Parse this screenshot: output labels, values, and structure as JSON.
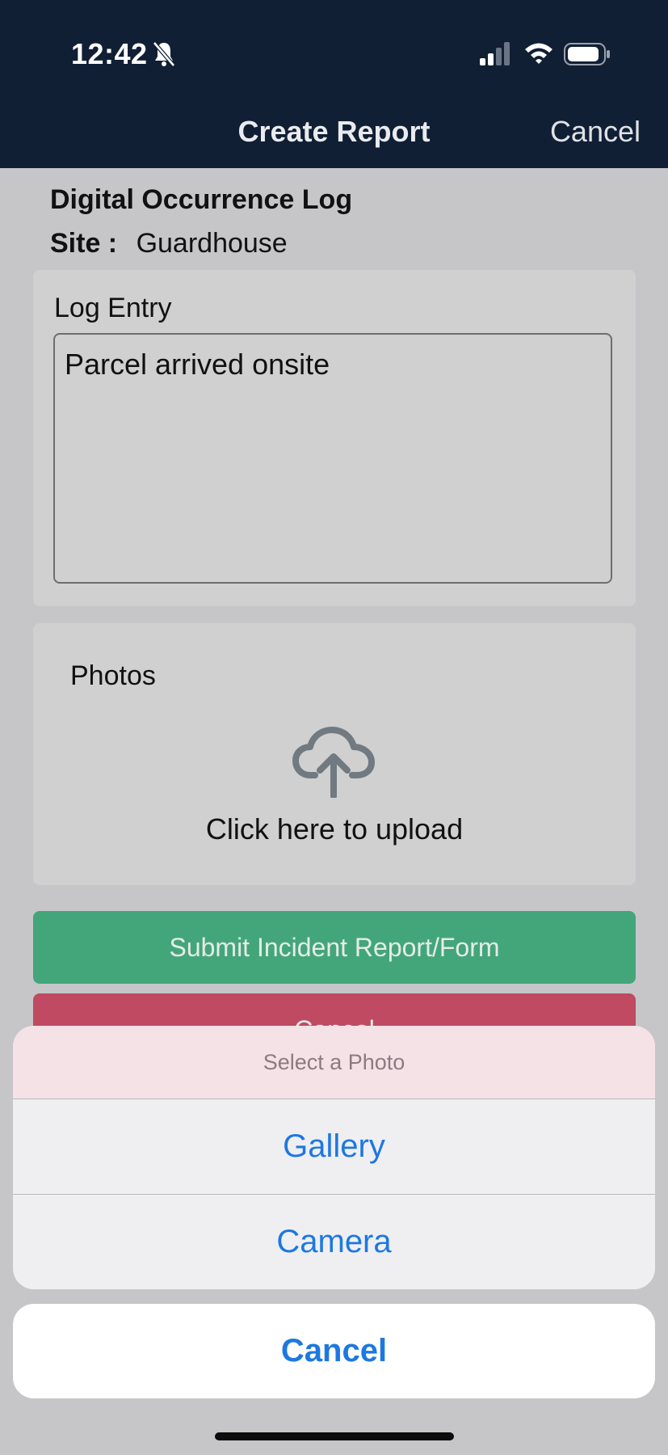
{
  "status_bar": {
    "time": "12:42",
    "icons": [
      "bell-slash-icon",
      "signal-icon",
      "wifi-icon",
      "battery-icon"
    ]
  },
  "nav": {
    "title": "Create Report",
    "cancel_label": "Cancel"
  },
  "form": {
    "heading": "Digital Occurrence Log",
    "site_label": "Site :",
    "site_value": "Guardhouse",
    "log_entry_label": "Log Entry",
    "log_entry_value": "Parcel arrived onsite",
    "photos_label": "Photos",
    "upload_text": "Click here to upload",
    "upload_icon": "cloud-upload-icon",
    "submit_label": "Submit Incident Report/Form",
    "cancel_label": "Cancel"
  },
  "action_sheet": {
    "title": "Select a Photo",
    "options": [
      "Gallery",
      "Camera"
    ],
    "cancel_label": "Cancel"
  },
  "colors": {
    "header_bg": "#111f35",
    "submit_green": "#43a67a",
    "cancel_red": "#bf4a62",
    "ios_blue": "#1d78e0"
  }
}
